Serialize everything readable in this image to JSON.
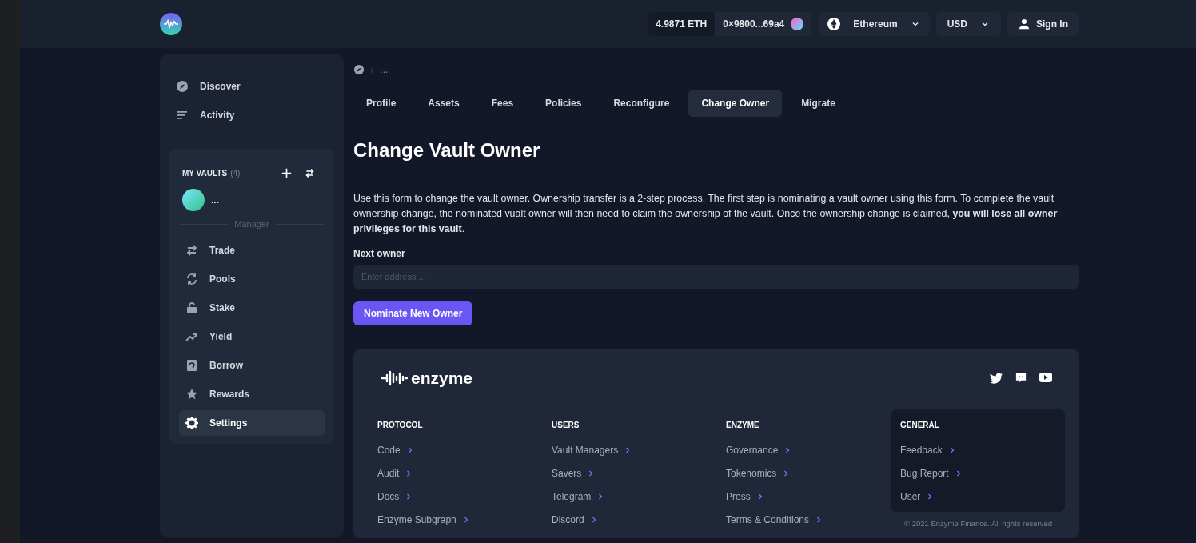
{
  "header": {
    "balance": "4.9871 ETH",
    "account": "0×9800...69a4",
    "network": "Ethereum",
    "currency": "USD",
    "sign_in": "Sign In"
  },
  "sidebar": {
    "nav": [
      {
        "label": "Discover",
        "selected": false
      },
      {
        "label": "Activity",
        "selected": false
      }
    ],
    "vaults": {
      "title": "MY VAULTS",
      "count": "(4)",
      "vault_name": "...",
      "section": "Manager",
      "items": [
        {
          "label": "Trade",
          "selected": false
        },
        {
          "label": "Pools",
          "selected": false
        },
        {
          "label": "Stake",
          "selected": false
        },
        {
          "label": "Yield",
          "selected": false
        },
        {
          "label": "Borrow",
          "selected": false
        },
        {
          "label": "Rewards",
          "selected": false
        },
        {
          "label": "Settings",
          "selected": true
        }
      ]
    }
  },
  "breadcrumb": {
    "separator": "/",
    "current": "..."
  },
  "tabs": [
    {
      "label": "Profile",
      "selected": false
    },
    {
      "label": "Assets",
      "selected": false
    },
    {
      "label": "Fees",
      "selected": false
    },
    {
      "label": "Policies",
      "selected": false
    },
    {
      "label": "Reconfigure",
      "selected": false
    },
    {
      "label": "Change Owner",
      "selected": true
    },
    {
      "label": "Migrate",
      "selected": false
    }
  ],
  "title": "Change Vault Owner",
  "description": "Use this form to change the vault owner. Ownership transfer is a 2-step process. The first step is nominating a vault owner using this form. To complete the vault ownership change, the nominated vualt owner will then need to claim the ownership of the vault. Once the ownership change is claimed, **you will lose all owner privileges for this vault**.",
  "form": {
    "label": "Next owner",
    "placeholder": "Enter address ...",
    "button": "Nominate New Owner"
  },
  "footer": {
    "logo": "enzyme",
    "columns": [
      {
        "title": "PROTOCOL",
        "highlighted": false,
        "links": [
          "Code",
          "Audit",
          "Docs",
          "Enzyme Subgraph"
        ]
      },
      {
        "title": "USERS",
        "highlighted": false,
        "links": [
          "Vault Managers",
          "Savers",
          "Telegram",
          "Discord"
        ]
      },
      {
        "title": "ENZYME",
        "highlighted": false,
        "links": [
          "Governance",
          "Tokenomics",
          "Press",
          "Terms & Conditions"
        ]
      },
      {
        "title": "GENERAL",
        "highlighted": true,
        "links": [
          "Feedback",
          "Bug Report",
          "User"
        ]
      }
    ],
    "copyright": "© 2021 Enzyme Finance. All rights reserved"
  }
}
